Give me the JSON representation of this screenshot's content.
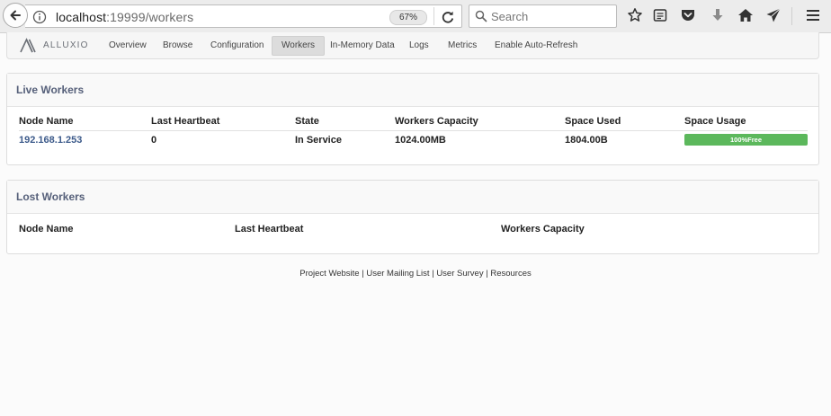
{
  "browser": {
    "url_host": "localhost",
    "url_rest": ":19999/workers",
    "zoom": "67%",
    "search_placeholder": "Search"
  },
  "navbar": {
    "brand": "ALLUXIO",
    "items": [
      {
        "label": "Overview"
      },
      {
        "label": "Browse"
      },
      {
        "label": "Configuration"
      },
      {
        "label": "Workers",
        "active": true
      },
      {
        "label": "In-Memory Data"
      },
      {
        "label": "Logs"
      },
      {
        "label": "Metrics"
      },
      {
        "label": "Enable Auto-Refresh"
      }
    ]
  },
  "live_workers": {
    "title": "Live Workers",
    "columns": [
      "Node Name",
      "Last Heartbeat",
      "State",
      "Workers Capacity",
      "Space Used",
      "Space Usage"
    ],
    "rows": [
      {
        "node_name": "192.168.1.253",
        "last_heartbeat": "0",
        "state": "In Service",
        "capacity": "1024.00MB",
        "space_used": "1804.00B",
        "space_usage_label": "100%Free",
        "space_free_fraction": 1.0
      }
    ]
  },
  "lost_workers": {
    "title": "Lost Workers",
    "columns": [
      "Node Name",
      "Last Heartbeat",
      "Workers Capacity"
    ]
  },
  "footer": {
    "links": [
      "Project Website",
      "User Mailing List",
      "User Survey",
      "Resources"
    ],
    "separator": " | "
  },
  "colors": {
    "progress_bar": "#5cb85c",
    "heading_text": "#56607a",
    "link": "#3c5a8a"
  }
}
